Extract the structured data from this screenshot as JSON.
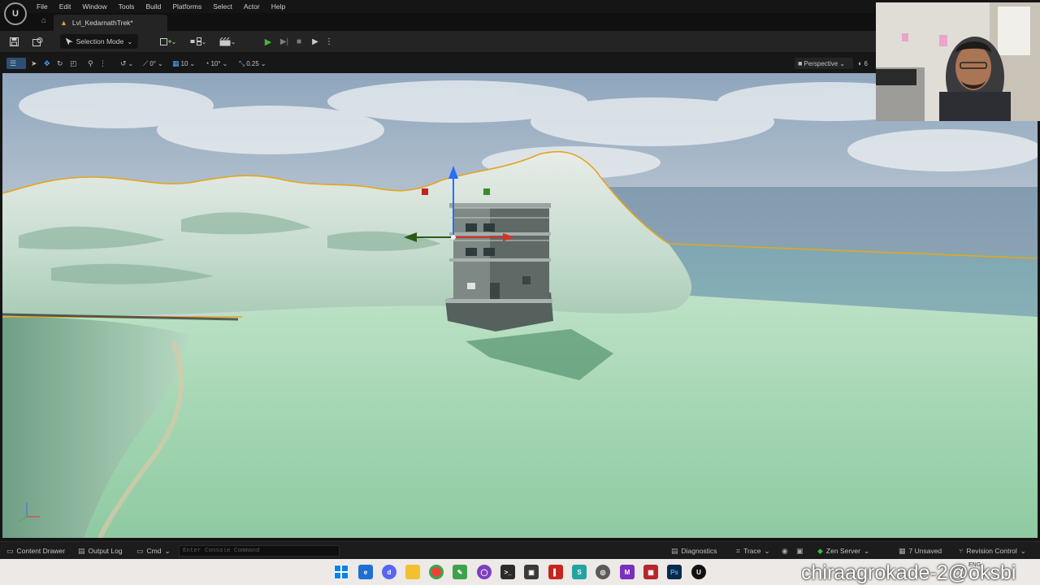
{
  "menubar": {
    "logo": "U",
    "items": [
      "File",
      "Edit",
      "Window",
      "Tools",
      "Build",
      "Platforms",
      "Select",
      "Actor",
      "Help"
    ]
  },
  "tabs": {
    "level": "Lvl_KedarnathTrek*"
  },
  "toolbar": {
    "selection_mode": "Selection Mode",
    "icons": [
      "save-icon",
      "content-browser-icon",
      "add-actor-icon",
      "blueprint-icon",
      "cinematics-icon",
      "play-icon",
      "step-icon",
      "stop-icon",
      "launch-icon",
      "more-icon"
    ]
  },
  "viewport_toolbar": {
    "rotation_snap": "0°",
    "grid_snap": "10",
    "angle_snap": "10°",
    "scale_snap": "0.25",
    "view_mode": "Perspective",
    "lit_short": "6"
  },
  "statusbar": {
    "content_drawer": "Content Drawer",
    "output_log": "Output Log",
    "cmd": "Cmd",
    "console_placeholder": "Enter Console Command",
    "diagnostics": "Diagnostics",
    "trace": "Trace",
    "zen_server": "Zen Server",
    "unsaved": "7 Unsaved",
    "revision_control": "Revision Control"
  },
  "taskbar": {
    "tray_lang": "ENG",
    "apps": [
      "windows-start-icon",
      "browser-edge-icon",
      "discord-icon",
      "explorer-icon",
      "chrome-icon",
      "notepad-icon",
      "github-icon",
      "terminal-icon",
      "app-icon",
      "app-icon-red",
      "app-icon-teal",
      "app-icon-gray",
      "visual-studio-icon",
      "app-icon-red2",
      "photoshop-icon",
      "unreal-icon"
    ]
  },
  "watermark": "chiraagrokade-2@oksbi",
  "colors": {
    "ue_dark": "#151515",
    "toolbar": "#242424",
    "play_green": "#3fb83a",
    "selection_outline": "#e5a51e",
    "sky": "#9fb3c7",
    "terrain_green": "#a9d8b5"
  }
}
